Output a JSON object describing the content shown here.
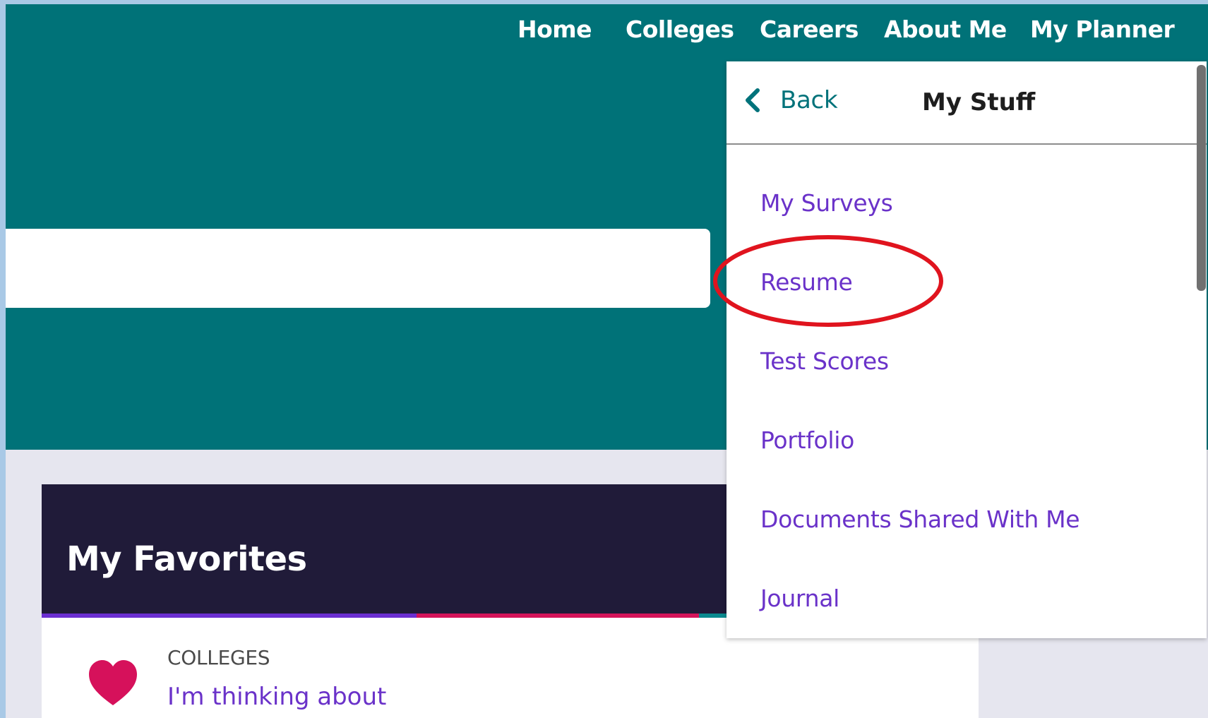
{
  "nav": {
    "home": "Home",
    "colleges": "Colleges",
    "careers": "Careers",
    "about_me": "About Me",
    "my_planner": "My Planner"
  },
  "search": {
    "placeholder": ""
  },
  "dropdown": {
    "back_label": "Back",
    "title": "My Stuff",
    "items": [
      {
        "label": "My Surveys"
      },
      {
        "label": "Resume"
      },
      {
        "label": "Test Scores"
      },
      {
        "label": "Portfolio"
      },
      {
        "label": "Documents Shared With Me"
      },
      {
        "label": "Journal"
      }
    ],
    "highlighted_item": "Resume"
  },
  "favorites": {
    "title": "My Favorites",
    "category": "COLLEGES",
    "link": "I'm thinking about"
  },
  "icons": {
    "back": "chevron-left-icon",
    "favorite": "heart-icon"
  },
  "colors": {
    "hero": "#007278",
    "page_bg": "#e6e6ef",
    "frame": "#a9c9e6",
    "card_header": "#201b39",
    "link_purple": "#6a32c9",
    "accent_teal": "#00727a",
    "heart_pink": "#d6115b",
    "stripe_purple": "#6b2fd1",
    "stripe_red": "#d4145a",
    "stripe_teal": "#0a8a8f",
    "highlight_red": "#e0141e"
  }
}
